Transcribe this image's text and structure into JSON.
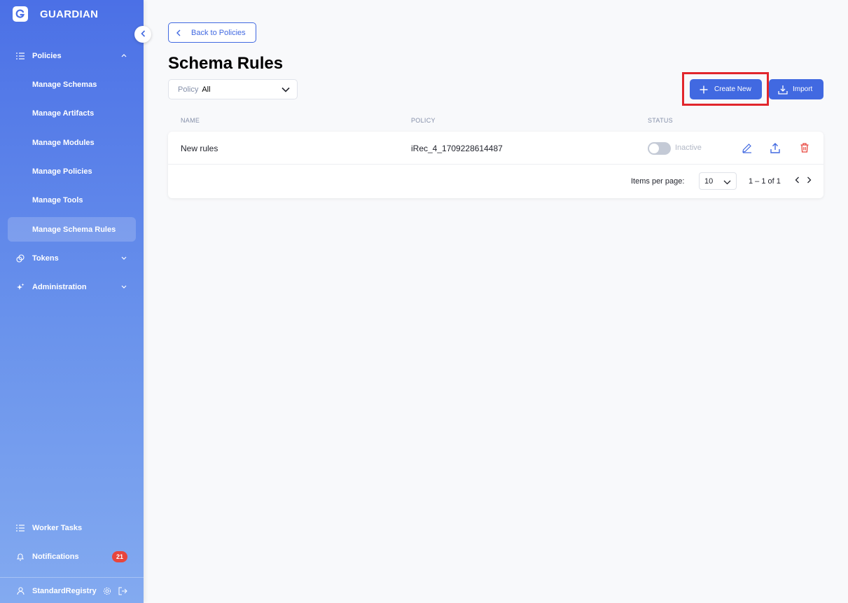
{
  "app": {
    "name": "GUARDIAN"
  },
  "sidebar": {
    "items": [
      {
        "label": "Policies"
      },
      {
        "label": "Manage Schemas"
      },
      {
        "label": "Manage Artifacts"
      },
      {
        "label": "Manage Modules"
      },
      {
        "label": "Manage Policies"
      },
      {
        "label": "Manage Tools"
      },
      {
        "label": "Manage Schema Rules"
      },
      {
        "label": "Tokens"
      },
      {
        "label": "Administration"
      }
    ],
    "bottom": [
      {
        "label": "Worker Tasks"
      },
      {
        "label": "Notifications",
        "badge": "21"
      }
    ],
    "user": {
      "name": "StandardRegistry"
    }
  },
  "header": {
    "back_label": "Back to Policies",
    "title": "Schema Rules"
  },
  "filter": {
    "label": "Policy",
    "value": "All"
  },
  "actions": {
    "create_label": "Create New",
    "import_label": "Import"
  },
  "table": {
    "columns": [
      "NAME",
      "POLICY",
      "STATUS"
    ],
    "rows": [
      {
        "name": "New rules",
        "policy": "iRec_4_1709228614487",
        "status": "Inactive"
      }
    ]
  },
  "paginator": {
    "items_per_page_label": "Items per page:",
    "page_size": "10",
    "range": "1 – 1 of 1"
  },
  "colors": {
    "accent": "#4169e1",
    "danger": "#e8453c",
    "highlight": "#e1262c"
  }
}
